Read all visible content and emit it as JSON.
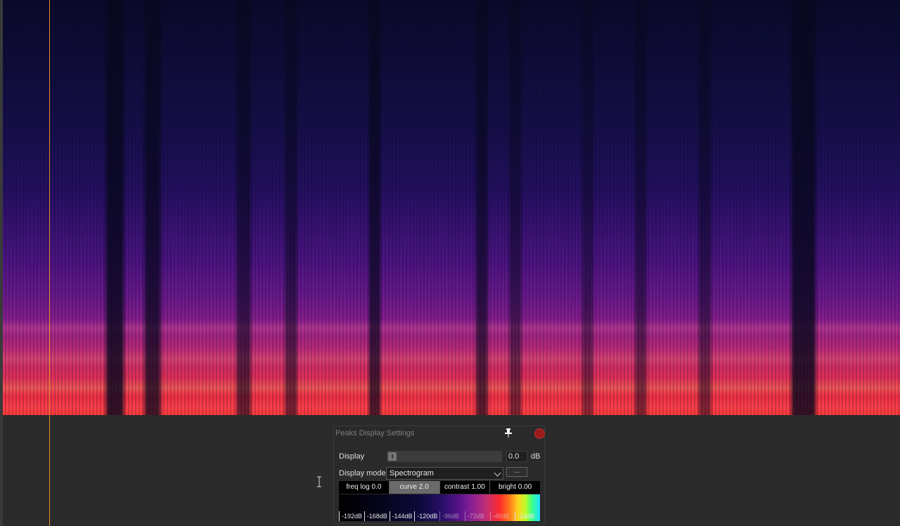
{
  "panel": {
    "title": "Peaks Display Settings",
    "display_label": "Display",
    "display_value": "0.0",
    "display_unit": "dB",
    "mode_label": "Display mode:",
    "mode_value": "Spectrogram",
    "more_label": "...",
    "tabs": [
      "freq log 0.0",
      "curve 2.0",
      "contrast 1.00",
      "bright 0.00"
    ],
    "active_tab": "curve 2.0",
    "colorbar_ticks": [
      "-192dB",
      "-168dB",
      "-144dB",
      "-120dB",
      "-96dB",
      "-72dB",
      "-48dB",
      "-24dB"
    ]
  },
  "colors": {
    "playhead": "#e08a2a",
    "close": "#9b1a1a",
    "panel_bg": "#2a2a2a"
  },
  "icons": {
    "pin": "pin-icon",
    "close": "close-icon",
    "text_cursor": "text-cursor-icon"
  }
}
